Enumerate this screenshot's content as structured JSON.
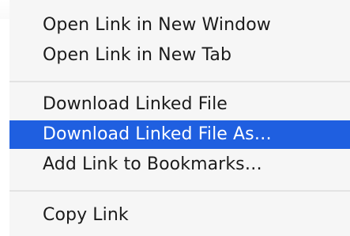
{
  "context_menu": {
    "items": [
      {
        "label": "Open Link in New Window"
      },
      {
        "label": "Open Link in New Tab"
      },
      {
        "label": "Download Linked File"
      },
      {
        "label": "Download Linked File As…"
      },
      {
        "label": "Add Link to Bookmarks…"
      },
      {
        "label": "Copy Link"
      }
    ],
    "highlighted_index": 3,
    "colors": {
      "background": "#f6f6f6",
      "highlight": "#1f5fe0",
      "text": "#1b1b1b",
      "highlight_text": "#ffffff",
      "separator": "#e3e3e3"
    }
  }
}
